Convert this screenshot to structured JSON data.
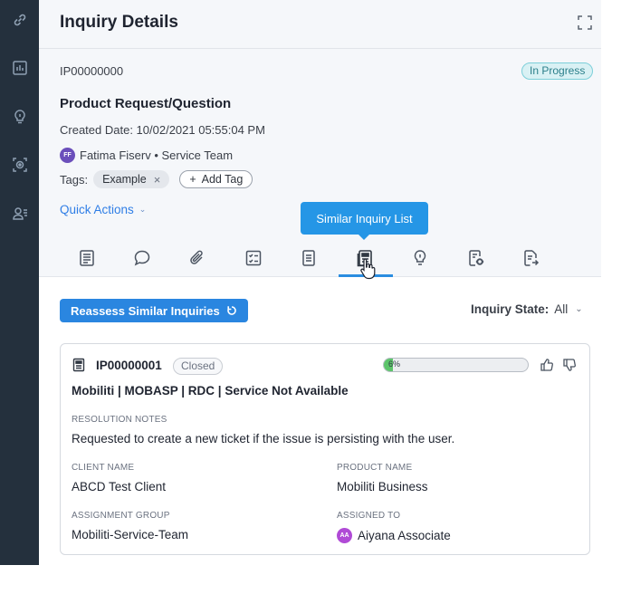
{
  "rail": {
    "icons": [
      "link-icon",
      "bar-chart-icon",
      "lightbulb-icon",
      "target-scan-icon",
      "user-list-icon"
    ]
  },
  "header": {
    "title": "Inquiry Details",
    "expand_icon": "expand-icon"
  },
  "inquiry": {
    "id": "IP00000000",
    "status": "In Progress",
    "title": "Product Request/Question",
    "created": "Created Date: 10/02/2021 05:55:04 PM",
    "owner_initials": "FF",
    "owner": "Fatima Fiserv • Service Team",
    "tags_label": "Tags:",
    "tags": [
      "Example"
    ],
    "tag_remove_glyph": "×",
    "add_tag_glyph": "+",
    "add_tag_label": "Add Tag",
    "quick_actions_label": "Quick Actions",
    "quick_actions_chevron": "⌄"
  },
  "tabs": {
    "tooltip": "Similar Inquiry List",
    "active_index": 5,
    "items": [
      "details-icon",
      "comment-icon",
      "attachment-icon",
      "checklist-icon",
      "notes-icon",
      "similar-inquiry-list-icon",
      "lightbulb-icon",
      "document-view-icon",
      "document-forward-icon"
    ]
  },
  "similar": {
    "reassess_label": "Reassess Similar Inquiries",
    "reassess_icon": "refresh-icon",
    "state_label": "Inquiry State:",
    "state_value": "All",
    "state_chevron": "⌄"
  },
  "card": {
    "id": "IP00000001",
    "status": "Closed",
    "score_text": "6%",
    "score_fraction": 0.06,
    "title": "Mobiliti | MOBASP | RDC | Service Not Available",
    "resolution_label": "RESOLUTION NOTES",
    "resolution_value": "Requested to create a new ticket if the issue is persisting with the user.",
    "client_label": "CLIENT NAME",
    "client_value": "ABCD Test Client",
    "product_label": "PRODUCT NAME",
    "product_value": "Mobiliti Business",
    "group_label": "ASSIGNMENT GROUP",
    "group_value": "Mobiliti-Service-Team",
    "assigned_label": "ASSIGNED TO",
    "assigned_initials": "AA",
    "assigned_value": "Aiyana Associate"
  },
  "colors": {
    "rail": "#24303d",
    "accent": "#2a86e0",
    "tooltip": "#2596e6",
    "status_in_progress": "#d9f1f4",
    "score_fill": "#5cc46a"
  }
}
